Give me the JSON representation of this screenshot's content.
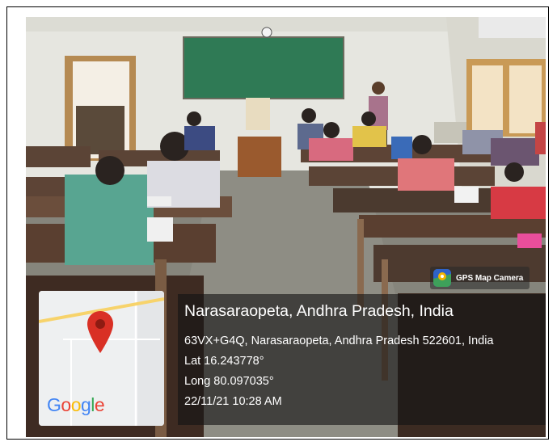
{
  "overlay": {
    "camera_label": "GPS Map Camera",
    "location_title": "Narasaraopeta, Andhra Pradesh, India",
    "address": "63VX+G4Q, Narasaraopeta, Andhra Pradesh 522601, India",
    "latitude": "Lat 16.243778°",
    "longitude": "Long 80.097035°",
    "datetime": "22/11/21 10:28 AM"
  },
  "map": {
    "brand_letters": [
      "G",
      "o",
      "o",
      "g",
      "l",
      "e"
    ],
    "brand_colors": [
      "#4285F4",
      "#EA4335",
      "#FBBC05",
      "#4285F4",
      "#34A853",
      "#EA4335"
    ],
    "pin_color": "#d93025"
  },
  "icons": {
    "camera_badge": "map-pin-camera-icon",
    "location_pin": "map-marker-icon"
  }
}
